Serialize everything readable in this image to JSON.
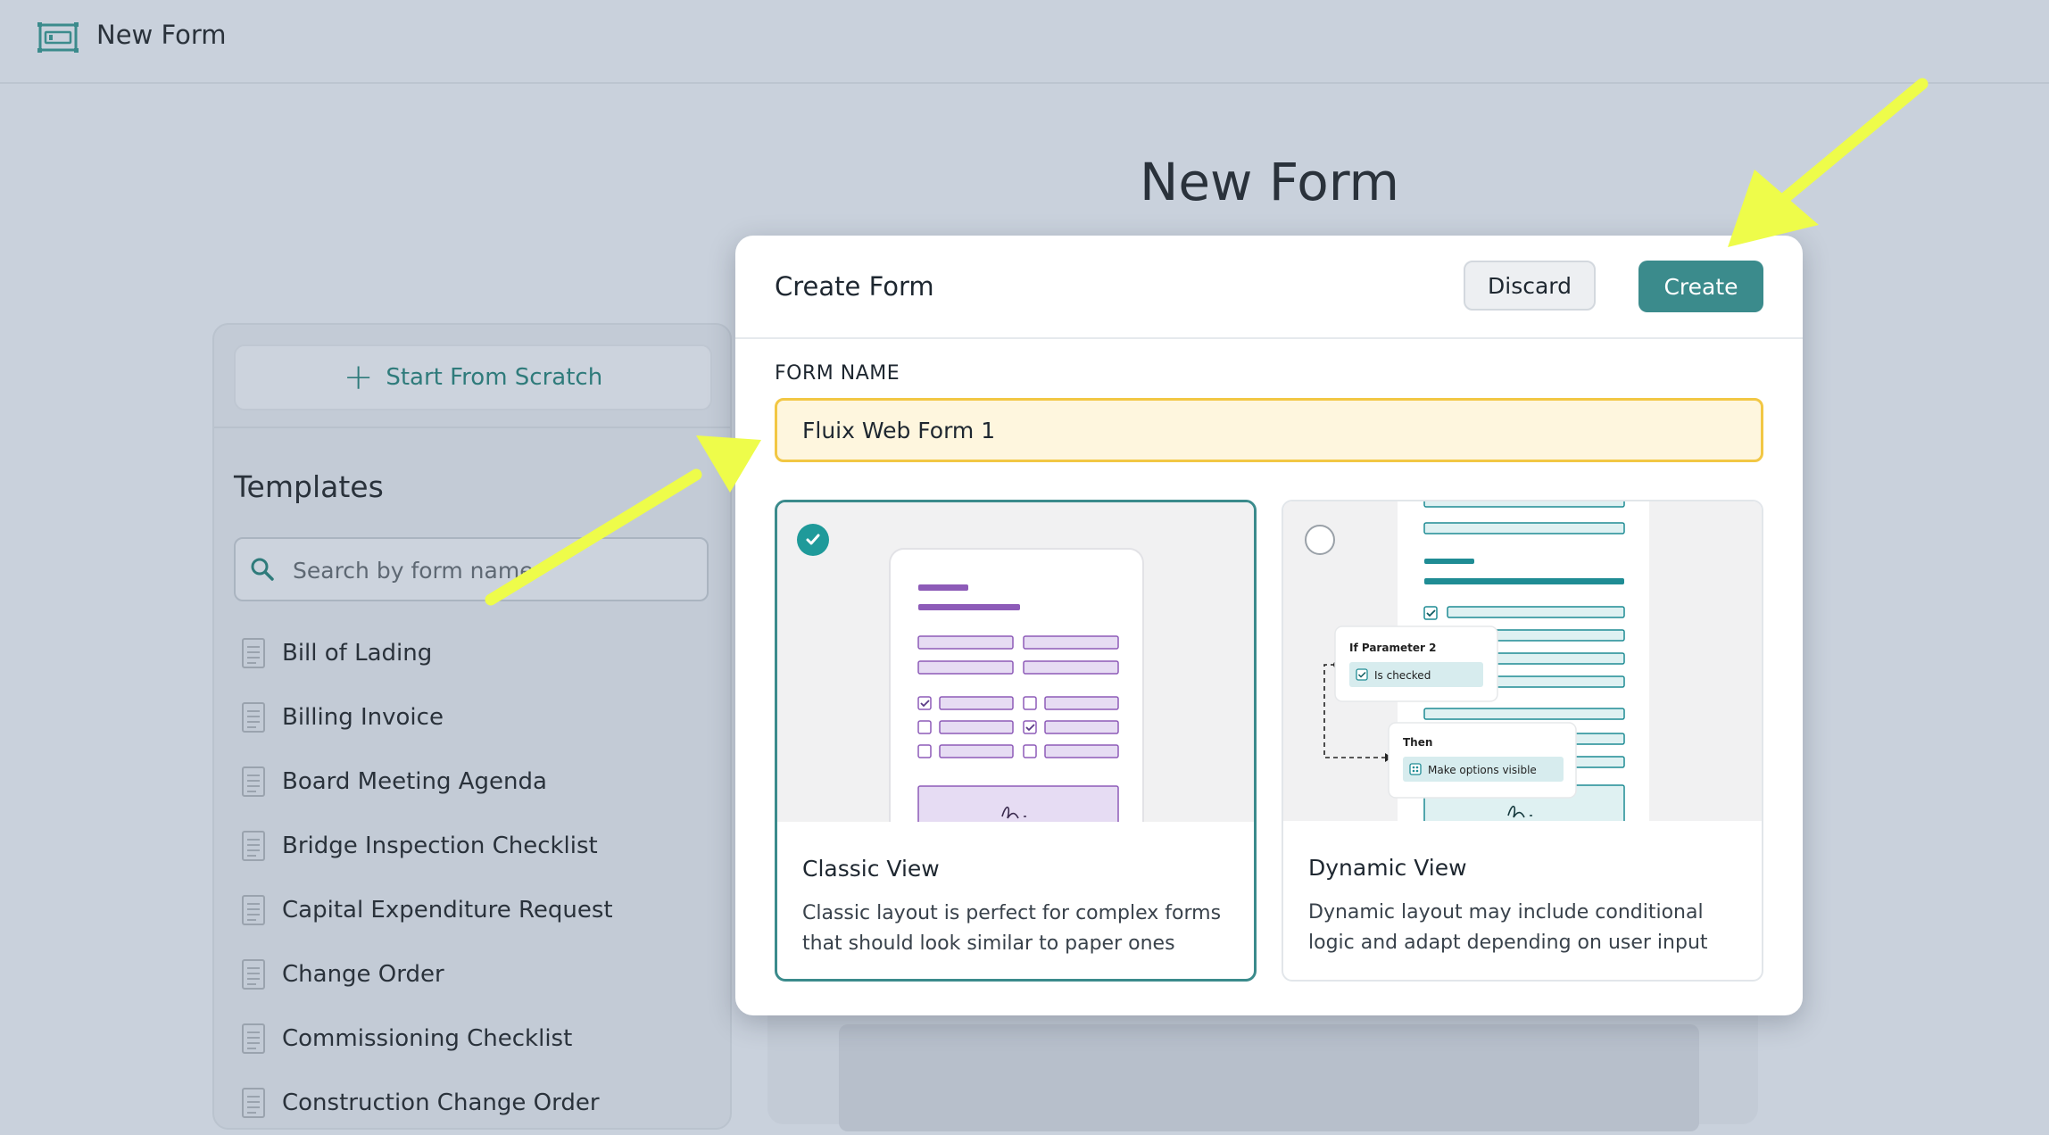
{
  "app": {
    "title": "New Form",
    "icon": "form-window-icon"
  },
  "page": {
    "heading": "New Form"
  },
  "sidebar": {
    "start_label": "Start From Scratch",
    "templates_title": "Templates",
    "search_placeholder": "Search by form name",
    "templates": [
      "Bill of Lading",
      "Billing Invoice",
      "Board Meeting Agenda",
      "Bridge Inspection Checklist",
      "Capital Expenditure Request",
      "Change Order",
      "Commissioning Checklist",
      "Construction Change Order"
    ]
  },
  "modal": {
    "title": "Create Form",
    "discard_label": "Discard",
    "create_label": "Create",
    "field_label": "FORM NAME",
    "form_name_value": "Fluix Web Form 1",
    "options": {
      "classic": {
        "name": "Classic View",
        "description": "Classic layout is perfect for complex forms that should look similar to paper ones",
        "selected": true
      },
      "dynamic": {
        "name": "Dynamic View",
        "description": "Dynamic layout may include conditional logic and adapt depending on user input",
        "selected": false,
        "preview": {
          "if_label": "If Parameter 2",
          "condition_label": "Is checked",
          "then_label": "Then",
          "action_label": "Make options visible"
        }
      }
    }
  },
  "colors": {
    "accent": "#3b8b8c",
    "overlay": "#c9d1dc",
    "input_highlight": "#fef6de",
    "input_border": "#f2c744",
    "arrow": "#eefc4a",
    "classic_purple": "#8d5bb8",
    "dynamic_teal": "#1f8c94"
  }
}
